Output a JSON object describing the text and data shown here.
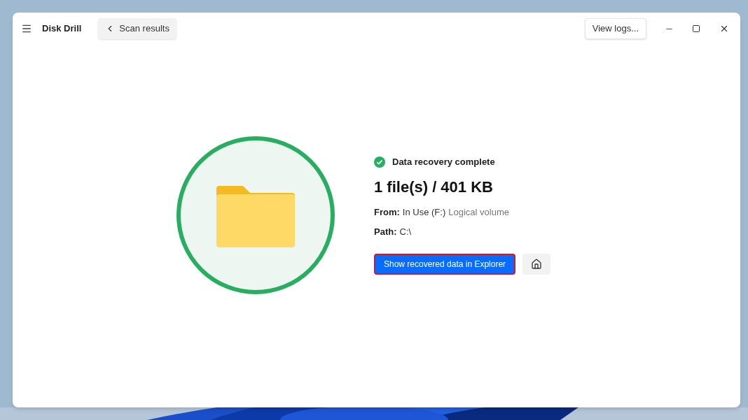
{
  "window": {
    "title": "Disk Drill"
  },
  "back_button": {
    "label": "Scan results"
  },
  "view_logs_button": {
    "label": "View logs..."
  },
  "result": {
    "status": "Data recovery complete",
    "summary": "1 file(s) / 401 KB",
    "from": {
      "label": "From:",
      "value": "In Use (F:)",
      "detail": "Logical volume"
    },
    "path": {
      "label": "Path:",
      "value": "C:\\"
    }
  },
  "primary_button": {
    "label": "Show recovered data in Explorer",
    "highlighted": true
  }
}
